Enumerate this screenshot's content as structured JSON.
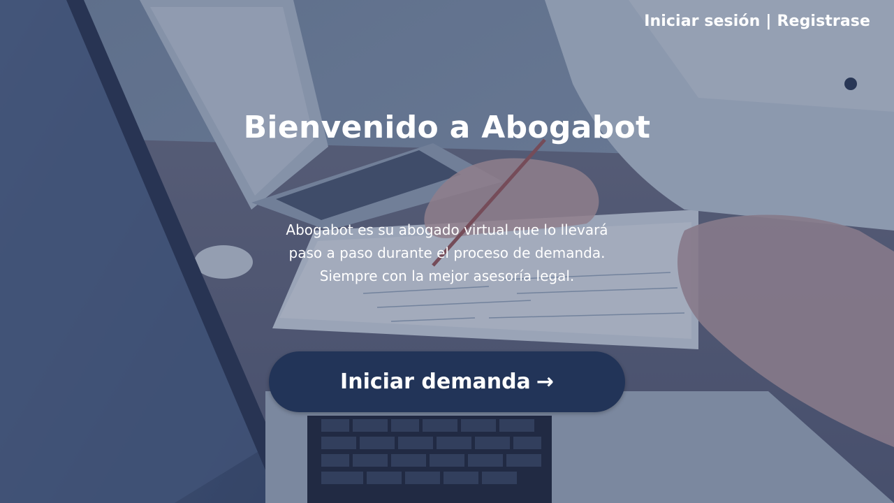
{
  "header": {
    "login_label": "Iniciar sesión",
    "separator": "|",
    "register_label": "Registrase"
  },
  "hero": {
    "title": "Bienvenido a Abogabot",
    "description_lines": [
      "Abogabot es su abogado virtual que lo llevará",
      "paso a paso durante el proceso de demanda.",
      "Siempre con la mejor asesoría legal."
    ],
    "cta_label": "Iniciar demanda",
    "cta_arrow": "→"
  },
  "colors": {
    "overlay": "#3f5773",
    "button": "#223458",
    "text": "#ffffff"
  }
}
